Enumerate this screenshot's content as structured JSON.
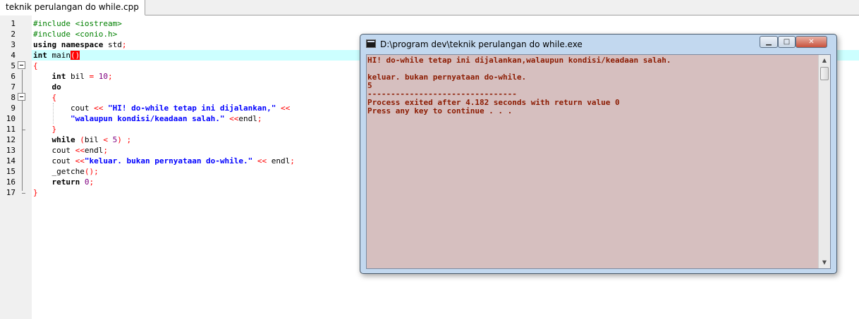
{
  "tab": {
    "label": "teknik perulangan do while.cpp"
  },
  "line_numbers": [
    "1",
    "2",
    "3",
    "4",
    "5",
    "6",
    "7",
    "8",
    "9",
    "10",
    "11",
    "12",
    "13",
    "14",
    "15",
    "16",
    "17"
  ],
  "code": {
    "l1": "#include <iostream>",
    "l2": "#include <conio.h>",
    "l3_kw1": "using",
    "l3_kw2": "namespace",
    "l3_rest": " std",
    "l3_semi": ";",
    "l4_kw": "int",
    "l4_fn": " main",
    "l4_paren": "()",
    "l5": "{",
    "l6_kw": "int",
    "l6_id": " bil ",
    "l6_op": "=",
    "l6_sp": " ",
    "l6_num": "10",
    "l6_semi": ";",
    "l7_kw": "do",
    "l8": "{",
    "l9_id": "cout ",
    "l9_op": "<<",
    "l9_sp": " ",
    "l9_str": "\"HI! do-while tetap ini dijalankan,\"",
    "l9_sp2": " ",
    "l9_op2": "<<",
    "l10_str": "\"walaupun kondisi/keadaan salah.\"",
    "l10_sp": " ",
    "l10_op": "<<",
    "l10_id": "endl",
    "l10_semi": ";",
    "l11": "}",
    "l12_kw": "while",
    "l12_sp": " ",
    "l12_p1": "(",
    "l12_id": "bil ",
    "l12_op": "<",
    "l12_sp2": " ",
    "l12_num": "5",
    "l12_p2": ")",
    "l12_sp3": " ",
    "l12_semi": ";",
    "l13_id": "cout ",
    "l13_op": "<<",
    "l13_id2": "endl",
    "l13_semi": ";",
    "l14_id": "cout ",
    "l14_op": "<<",
    "l14_str": "\"keluar. bukan pernyataan do-while.\"",
    "l14_sp": " ",
    "l14_op2": "<<",
    "l14_id2": " endl",
    "l14_semi": ";",
    "l15_id": "_getche",
    "l15_paren": "()",
    "l15_semi": ";",
    "l16_kw": "return",
    "l16_sp": " ",
    "l16_num": "0",
    "l16_semi": ";",
    "l17": "}"
  },
  "console": {
    "title": "D:\\program dev\\teknik perulangan do while.exe",
    "buttons": {
      "minimize": "▁",
      "maximize": "□",
      "close": "✕"
    },
    "lines": [
      "HI! do-while tetap ini dijalankan,walaupun kondisi/keadaan salah.",
      "",
      "keluar. bukan pernyataan do-while.",
      "5",
      "--------------------------------",
      "Process exited after 4.182 seconds with return value 0",
      "Press any key to continue . . ."
    ],
    "scroll_up": "▲",
    "scroll_down": "▼"
  },
  "colors": {
    "console_bg": "#d6bfbf",
    "console_text": "#8b1a00",
    "current_line": "#ccffff",
    "string": "#0000ff",
    "preprocessor": "#008000",
    "operator": "#ff0000"
  }
}
